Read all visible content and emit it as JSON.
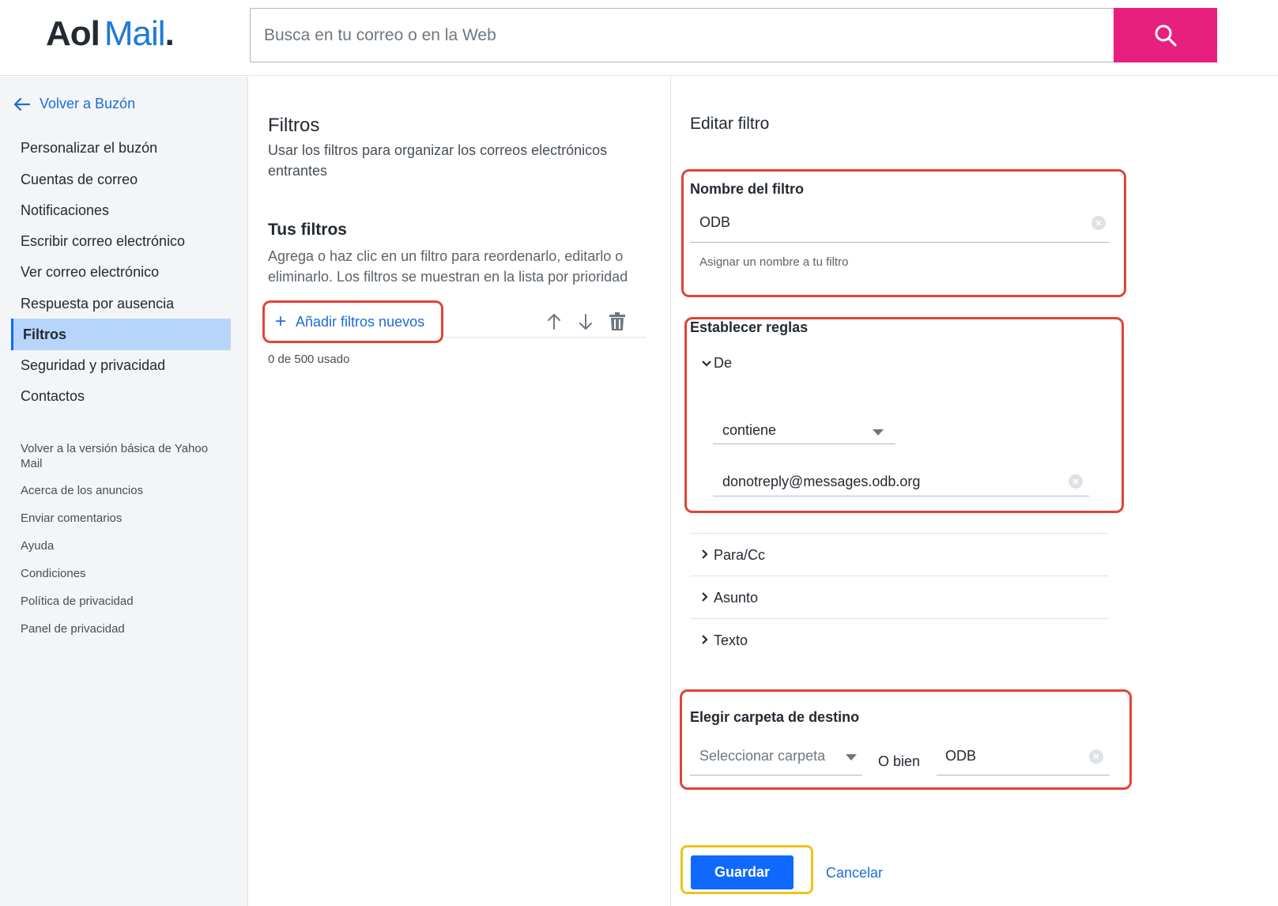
{
  "header": {
    "logo_aol": "Aol",
    "logo_mail": "Mail",
    "logo_dot": ".",
    "search_placeholder": "Busca en tu correo o en la Web",
    "search_icon": "search-icon",
    "search_color": "#e71f7e"
  },
  "sidebar": {
    "back_label": "Volver a Buzón",
    "items": [
      {
        "label": "Personalizar el buzón"
      },
      {
        "label": "Cuentas de correo"
      },
      {
        "label": "Notificaciones"
      },
      {
        "label": "Escribir correo electrónico"
      },
      {
        "label": "Ver correo electrónico"
      },
      {
        "label": "Respuesta por ausencia"
      },
      {
        "label": "Filtros",
        "active": true
      },
      {
        "label": "Seguridad y privacidad"
      },
      {
        "label": "Contactos"
      }
    ],
    "links": [
      {
        "label": "Volver a la versión básica de Yahoo Mail"
      },
      {
        "label": "Acerca de los anuncios"
      },
      {
        "label": "Enviar comentarios"
      },
      {
        "label": "Ayuda"
      },
      {
        "label": "Condiciones"
      },
      {
        "label": "Política de privacidad"
      },
      {
        "label": "Panel de privacidad"
      }
    ]
  },
  "filters": {
    "title": "Filtros",
    "description": "Usar los filtros para organizar los correos electrónicos entrantes",
    "your_filters_title": "Tus filtros",
    "your_filters_desc": "Agrega o haz clic en un filtro para reordenarlo, editarlo o eliminarlo. Los filtros se muestran en la lista por prioridad",
    "add_label": "Añadir filtros nuevos",
    "usage": "0 de 500 usado"
  },
  "edit": {
    "title": "Editar filtro",
    "name_label": "Nombre del filtro",
    "name_value": "ODB",
    "name_hint": "Asignar un nombre a tu filtro",
    "rules_label": "Establecer reglas",
    "from_label": "De",
    "from_condition": "contiene",
    "from_value": "donotreply@messages.odb.org",
    "rule_to": "Para/Cc",
    "rule_subject": "Asunto",
    "rule_text": "Texto",
    "folder_label": "Elegir carpeta de destino",
    "folder_select_placeholder": "Seleccionar carpeta",
    "or_label": "O bien",
    "folder_new_value": "ODB",
    "save_label": "Guardar",
    "cancel_label": "Cancelar",
    "highlight_color": "#e04436",
    "save_highlight_color": "#f2c21a",
    "accent_color": "#0f69ff"
  }
}
